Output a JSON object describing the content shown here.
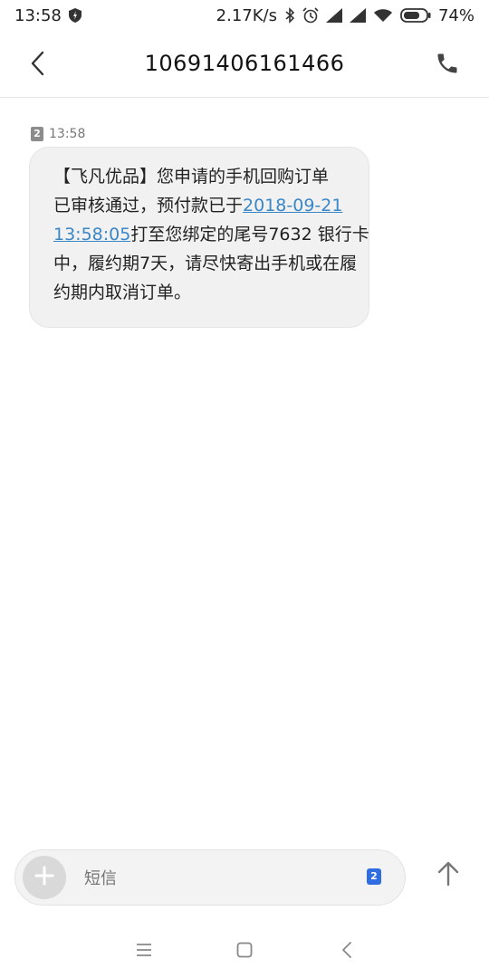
{
  "status_bar": {
    "time": "13:58",
    "network_speed": "2.17K/s",
    "battery_percent": "74%",
    "battery_level": 0.74,
    "icons": [
      "shield-icon",
      "bluetooth-icon",
      "alarm-icon",
      "signal-icon",
      "wifi-icon",
      "battery-icon"
    ]
  },
  "header": {
    "title": "10691406161466",
    "back_icon": "chevron-left-icon",
    "call_icon": "phone-icon"
  },
  "message": {
    "sim": "2",
    "time": "13:58",
    "lines": [
      {
        "text": "【飞凡优品】您申请的手机回购订单"
      },
      {
        "text": "已审核通过，预付款已于",
        "link": "2018-09-21"
      },
      {
        "link": "13:58:05",
        "text": "打至您绑定的尾号7632 银行卡"
      },
      {
        "text": "中，履约期7天，请尽快寄出手机或在履"
      },
      {
        "text": "约期内取消订单。"
      }
    ]
  },
  "composer": {
    "placeholder": "短信",
    "sim": "2",
    "add_icon": "plus-icon",
    "send_icon": "arrow-up-icon"
  },
  "nav": {
    "icons": [
      "menu-icon",
      "home-icon",
      "back-icon"
    ]
  },
  "colors": {
    "link": "#3a87c7",
    "bubble_bg": "#f1f1f1",
    "sim_badge": "#2f6de1"
  }
}
